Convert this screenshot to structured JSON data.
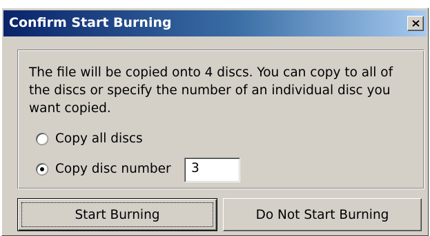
{
  "dialog": {
    "title": "Confirm Start Burning",
    "close_icon": "close-icon",
    "message": "The file will be copied onto 4 discs. You can copy to all of the discs or specify the number of an individual disc you want copied.",
    "options": [
      {
        "label": "Copy all discs",
        "selected": false
      },
      {
        "label": "Copy disc number",
        "selected": true
      }
    ],
    "disc_number_value": "3",
    "buttons": {
      "start": "Start Burning",
      "cancel": "Do Not Start Burning"
    }
  },
  "colors": {
    "title_gradient_start": "#0a246a",
    "title_gradient_end": "#a6caf0",
    "face": "#d4d0c8"
  }
}
